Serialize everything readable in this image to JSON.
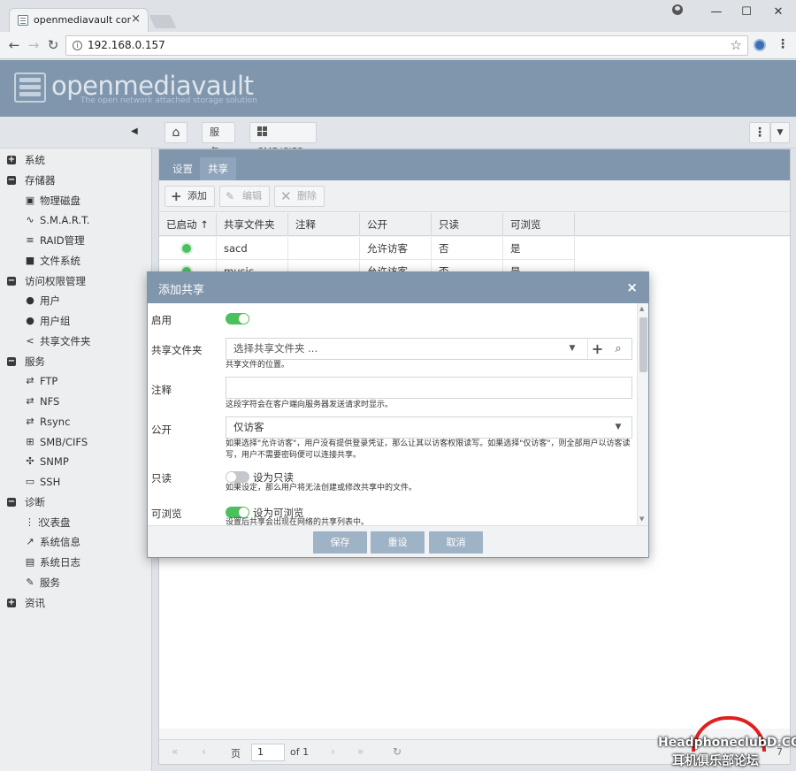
{
  "browser": {
    "tab_title": "openmediavault control panel",
    "tab_close": "×",
    "url": "192.168.0.157",
    "window_minimize": "—",
    "window_maximize": "☐",
    "window_close": "✕"
  },
  "app": {
    "logo_text": "openmediavault",
    "logo_subtitle": "The open network attached storage solution"
  },
  "breadcrumb": {
    "services": "服务",
    "smb": "SMB/CIFS"
  },
  "sidebar": {
    "items": [
      {
        "label": "系统",
        "level": "top",
        "icon": "plus-box-icon"
      },
      {
        "label": "存储器",
        "level": "top",
        "icon": "minus-box-icon"
      },
      {
        "label": "物理磁盘",
        "level": "sub",
        "icon": "disk-icon"
      },
      {
        "label": "S.M.A.R.T.",
        "level": "sub",
        "icon": "pulse-icon"
      },
      {
        "label": "RAID管理",
        "level": "sub",
        "icon": "database-icon"
      },
      {
        "label": "文件系统",
        "level": "sub",
        "icon": "folder-icon"
      },
      {
        "label": "访问权限管理",
        "level": "top",
        "icon": "minus-box-icon"
      },
      {
        "label": "用户",
        "level": "sub",
        "icon": "user-icon"
      },
      {
        "label": "用户组",
        "level": "sub",
        "icon": "users-icon"
      },
      {
        "label": "共享文件夹",
        "level": "sub",
        "icon": "share-icon"
      },
      {
        "label": "服务",
        "level": "top",
        "icon": "minus-box-icon"
      },
      {
        "label": "FTP",
        "level": "sub",
        "icon": "ftp-icon"
      },
      {
        "label": "NFS",
        "level": "sub",
        "icon": "nfs-icon"
      },
      {
        "label": "Rsync",
        "level": "sub",
        "icon": "rsync-icon"
      },
      {
        "label": "SMB/CIFS",
        "level": "sub",
        "icon": "windows-icon"
      },
      {
        "label": "SNMP",
        "level": "sub",
        "icon": "snmp-icon"
      },
      {
        "label": "SSH",
        "level": "sub",
        "icon": "terminal-icon"
      },
      {
        "label": "诊断",
        "level": "top",
        "icon": "minus-box-icon"
      },
      {
        "label": "仪表盘",
        "level": "sub",
        "icon": "grid-icon"
      },
      {
        "label": "系统信息",
        "level": "sub",
        "icon": "chart-icon"
      },
      {
        "label": "系统日志",
        "level": "sub",
        "icon": "log-icon"
      },
      {
        "label": "服务",
        "level": "sub",
        "icon": "wrench-icon"
      },
      {
        "label": "资讯",
        "level": "top",
        "icon": "plus-box-icon"
      }
    ]
  },
  "panel": {
    "tabs": [
      {
        "label": "设置",
        "active": false
      },
      {
        "label": "共享",
        "active": true
      }
    ],
    "toolbar": {
      "add": "添加",
      "edit": "编辑",
      "delete": "删除"
    },
    "columns": [
      "已启动 ↑",
      "共享文件夹",
      "注释",
      "公开",
      "只读",
      "可浏览"
    ],
    "rows": [
      {
        "enabled": true,
        "folder": "sacd",
        "comment": "",
        "public": "允许访客",
        "readonly": "否",
        "browsable": "是"
      },
      {
        "enabled": true,
        "folder": "music",
        "comment": "",
        "public": "允许访客",
        "readonly": "否",
        "browsable": "是"
      }
    ],
    "pager": {
      "page_label": "页",
      "page_value": "1",
      "of_label": "of 1",
      "summary": "7"
    }
  },
  "dialog": {
    "title": "添加共享",
    "close": "×",
    "enable_label": "启用",
    "enable_on": true,
    "folder_label": "共享文件夹",
    "folder_placeholder": "选择共享文件夹 ...",
    "folder_hint": "共享文件的位置。",
    "comment_label": "注释",
    "comment_value": "",
    "comment_hint": "这段字符会在客户端向服务器发送请求时显示。",
    "public_label": "公开",
    "public_value": "仅访客",
    "public_hint": "如果选择\"允许访客\"，用户没有提供登录凭证，那么让其以访客权限读写。如果选择\"仅访客\"，则全部用户以访客读写，用户不需要密码便可以连接共享。",
    "readonly_label": "只读",
    "readonly_on": false,
    "readonly_toggle_text": "设为只读",
    "readonly_hint": "如果设定，那么用户将无法创建或修改共享中的文件。",
    "browsable_label": "可浏览",
    "browsable_on": true,
    "browsable_toggle_text": "设为可浏览",
    "browsable_hint": "设置后共享会出现在网络的共享列表中。",
    "buttons": {
      "save": "保存",
      "reset": "重设",
      "cancel": "取消"
    }
  },
  "watermark": {
    "line1": "HeadphoneclubD.COM",
    "line2": "耳机俱乐部论坛"
  },
  "colors": {
    "header_blue": "#7f96ad",
    "toggle_on": "#4cc05e",
    "button_blue": "#9fb3c6",
    "watermark_red": "#e01f1f"
  }
}
